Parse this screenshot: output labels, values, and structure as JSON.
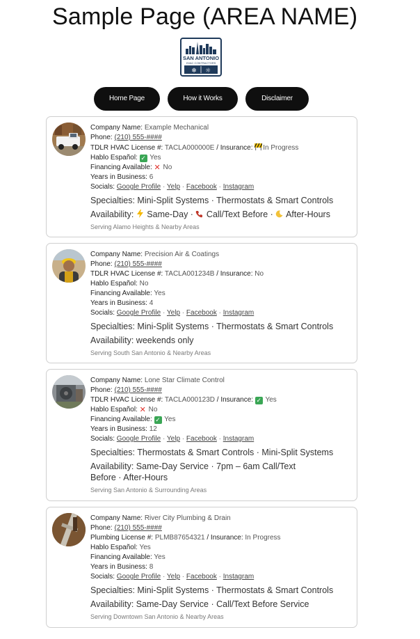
{
  "page": {
    "title": "Sample Page (AREA NAME)"
  },
  "logo": {
    "line1": "SAN ANTONIO",
    "line2": "HVAC CONTRACTORS"
  },
  "nav": {
    "home": "Home Page",
    "how": "How it Works",
    "disclaimer": "Disclaimer"
  },
  "labels": {
    "company": "Company Name:",
    "phone": "Phone:",
    "insurance": "/ Insurance:",
    "spanish": "Hablo Español:",
    "financing": "Financing Available:",
    "years": "Years in Business:",
    "socials": "Socials:",
    "specialties": "Specialties:",
    "availability": "Availability:"
  },
  "socials": {
    "google": "Google Profile",
    "yelp": "Yelp",
    "facebook": "Facebook",
    "instagram": "Instagram",
    "separator": "·"
  },
  "cards": [
    {
      "company": "Example Mechanical",
      "phone": "(210) 555-####",
      "license_label": "TDLR HVAC License #:",
      "license": "TACLA000000E",
      "insurance": "In Progress",
      "insurance_icon": "construction-sign-icon",
      "spanish": "Yes",
      "spanish_icon": "check-icon",
      "financing": "No",
      "financing_icon": "cross-icon",
      "years": "6",
      "specialties": "Mini-Split Systems · Thermostats & Smart Controls",
      "availability_parts": [
        "Same-Day",
        "Call/Text Before",
        "After-Hours"
      ],
      "availability_icons": [
        "lightning-icon",
        "phone-icon",
        "moon-icon"
      ],
      "serving": "Serving Alamo Heights & Nearby Areas",
      "avatar": "truck-photo-icon"
    },
    {
      "company": "Precision Air & Coatings",
      "phone": "(210) 555-####",
      "license_label": "TDLR HVAC License #:",
      "license": "TACLA001234B",
      "insurance": "No",
      "spanish": "No",
      "financing": "Yes",
      "years": "4",
      "specialties": "Mini-Split Systems · Thermostats & Smart Controls",
      "availability": "weekends only",
      "serving": "Serving South San Antonio & Nearby Areas",
      "avatar": "worker-photo-icon"
    },
    {
      "company": "Lone Star Climate Control",
      "phone": "(210) 555-####",
      "license_label": "TDLR HVAC License #:",
      "license": "TACLA000123D",
      "insurance": "Yes",
      "insurance_icon": "check-icon",
      "spanish": "No",
      "spanish_icon": "cross-icon",
      "financing": "Yes",
      "financing_icon": "check-icon",
      "years": "12",
      "specialties": "Thermostats & Smart Controls · Mini-Split Systems",
      "availability": "Same-Day Service · 7pm – 6am Call/Text Before · After-Hours",
      "serving": "Serving San Antonio & Surrounding Areas",
      "avatar": "hvac-unit-photo-icon"
    },
    {
      "company": "River City Plumbing & Drain",
      "phone": "(210) 555-####",
      "license_label": "Plumbing License #:",
      "license": "PLMB87654321",
      "insurance": "In Progress",
      "spanish": "Yes",
      "financing": "Yes",
      "years": "8",
      "specialties": "Mini-Split Systems · Thermostats & Smart Controls",
      "availability": "Same-Day Service · Call/Text Before Service",
      "serving": "Serving Downtown San Antonio & Nearby Areas",
      "avatar": "pipe-photo-icon"
    }
  ],
  "colors": {
    "nav_bg": "#0f0f0f",
    "logo_blue": "#1f3a5a",
    "check_green": "#3aa655",
    "cross_red": "#e0302a"
  }
}
